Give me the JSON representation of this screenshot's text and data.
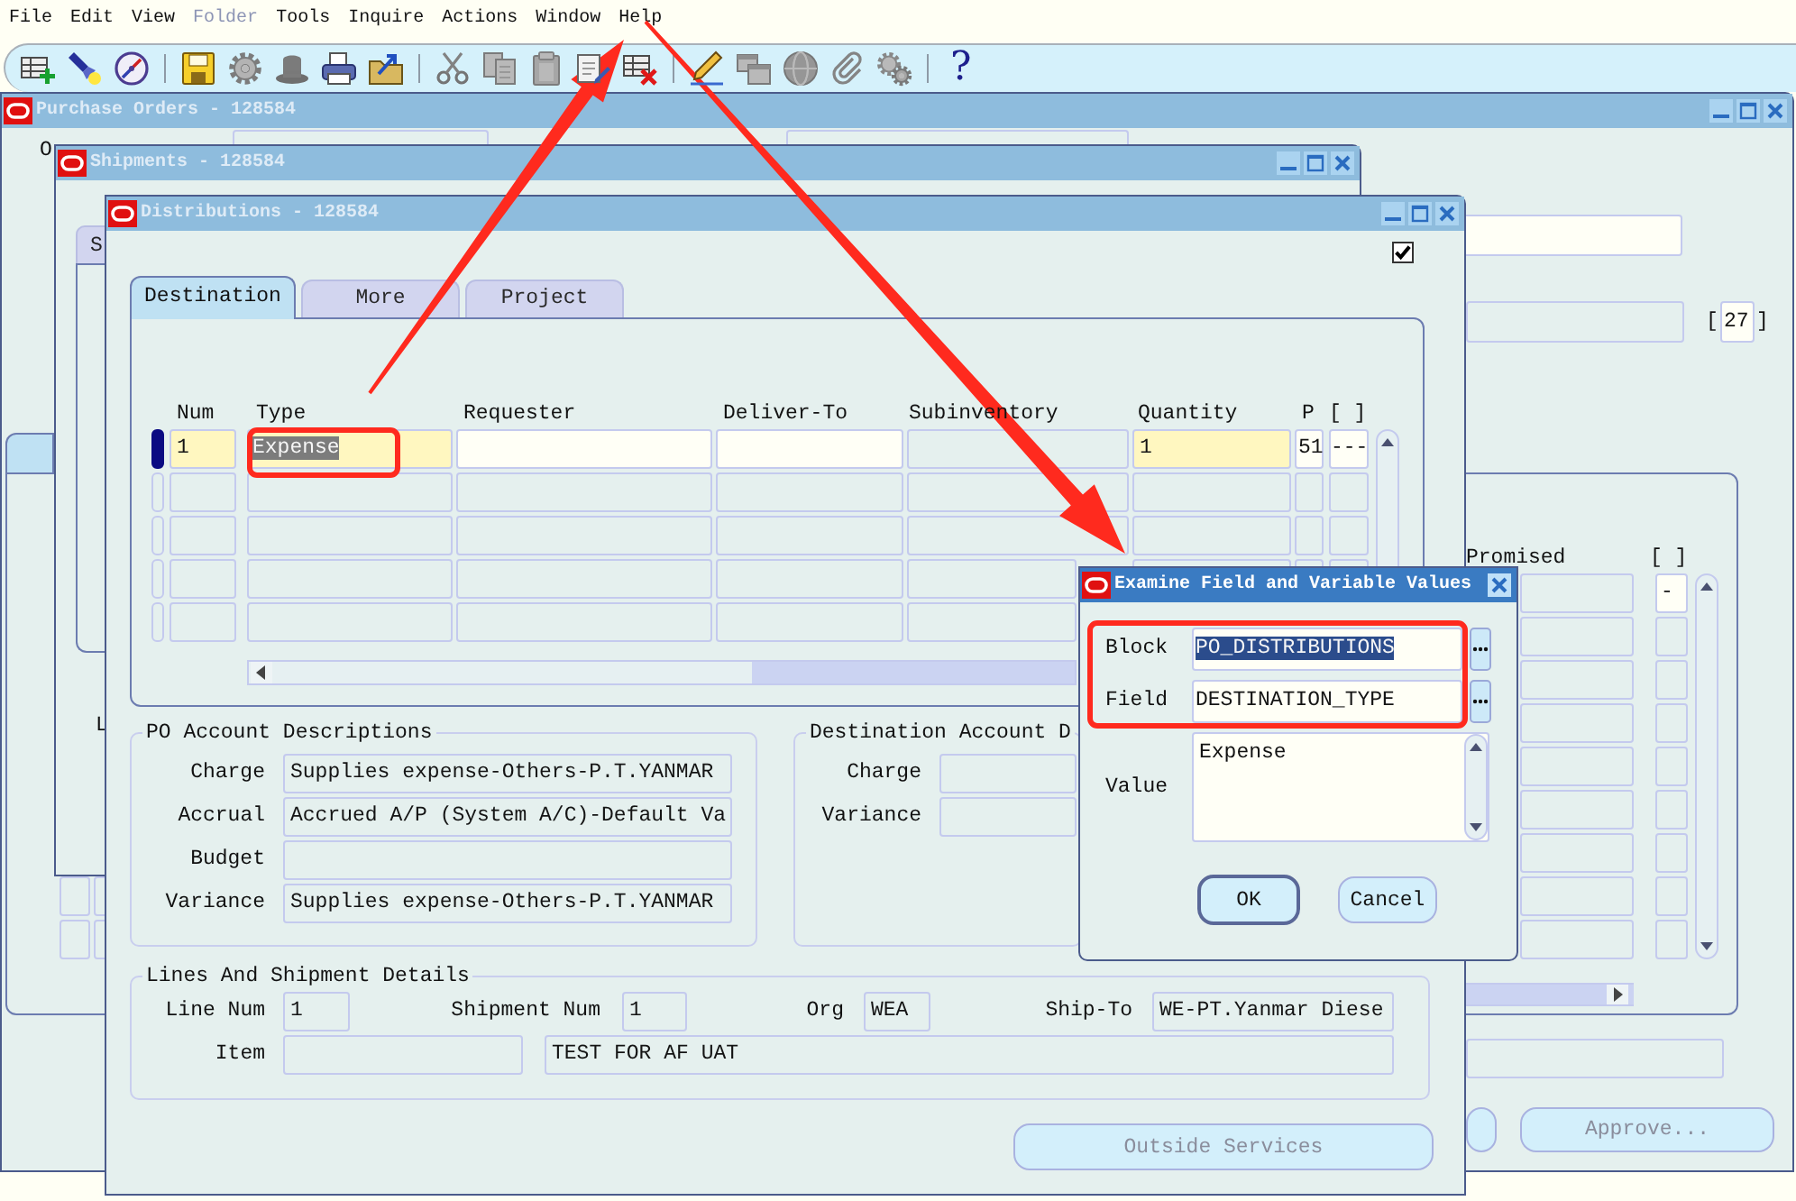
{
  "menu_bar": [
    {
      "label": "File",
      "disabled": false
    },
    {
      "label": "Edit",
      "disabled": false
    },
    {
      "label": "View",
      "disabled": false
    },
    {
      "label": "Folder",
      "disabled": true
    },
    {
      "label": "Tools",
      "disabled": false
    },
    {
      "label": "Inquire",
      "disabled": false
    },
    {
      "label": "Actions",
      "disabled": false
    },
    {
      "label": "Window",
      "disabled": false
    },
    {
      "label": "Help",
      "disabled": false
    }
  ],
  "toolbar": [
    {
      "kind": "new_record",
      "disabled": false
    },
    {
      "kind": "find",
      "disabled": false
    },
    {
      "kind": "navigator",
      "disabled": false
    },
    {
      "kind": "separator"
    },
    {
      "kind": "save",
      "disabled": false
    },
    {
      "kind": "next_step",
      "disabled": true
    },
    {
      "kind": "switch_responsibility",
      "disabled": true
    },
    {
      "kind": "print",
      "disabled": false
    },
    {
      "kind": "close_form",
      "disabled": false
    },
    {
      "kind": "separator"
    },
    {
      "kind": "cut",
      "disabled": true
    },
    {
      "kind": "copy",
      "disabled": true
    },
    {
      "kind": "paste",
      "disabled": true
    },
    {
      "kind": "clear_record",
      "disabled": false
    },
    {
      "kind": "delete_record",
      "disabled": false
    },
    {
      "kind": "separator"
    },
    {
      "kind": "edit_field",
      "disabled": false
    },
    {
      "kind": "zoom",
      "disabled": true
    },
    {
      "kind": "translations",
      "disabled": true
    },
    {
      "kind": "attachments",
      "disabled": true
    },
    {
      "kind": "folder_tools",
      "disabled": true
    },
    {
      "kind": "separator"
    },
    {
      "kind": "help",
      "glyph": "?",
      "disabled": false
    }
  ],
  "purchase_orders_window": {
    "title": "Purchase Orders - 128584",
    "active": false,
    "field_label": "O",
    "fields": [
      {
        "kind": "display"
      },
      {
        "kind": "display"
      },
      {
        "kind": "editable"
      },
      {
        "kind": "display"
      },
      {
        "kind": "display"
      }
    ],
    "flexfield": {
      "open": "[",
      "value": "27",
      "close": "]",
      "kind": "editable"
    },
    "tabs": [
      {
        "selected": true
      }
    ],
    "table": {
      "columns": [
        "Promised",
        "[ ]"
      ],
      "rows": [
        {
          "current": true,
          "flexfield": "-"
        },
        {
          "current": false
        },
        {
          "current": false
        },
        {
          "current": false
        },
        {
          "current": false
        },
        {
          "current": false
        },
        {
          "current": false
        },
        {
          "current": false
        },
        {
          "current": false
        }
      ]
    },
    "buttons": [
      {
        "kind": "blank"
      },
      {
        "kind": "labeled",
        "label": "Approve...",
        "disabled": true
      }
    ]
  },
  "shipments_window": {
    "title": "Shipments - 128584",
    "active": false,
    "tabs": [
      {
        "label": "S",
        "selected": false
      }
    ],
    "field_label": "L"
  },
  "distributions_window": {
    "title": "Distributions - 128584",
    "active": false,
    "checkbox": {
      "checked": true
    },
    "tabs": [
      {
        "label": "Destination",
        "selected": true
      },
      {
        "label": "More",
        "selected": false
      },
      {
        "label": "Project",
        "selected": false
      }
    ],
    "table": {
      "columns": [
        "Num",
        "Type",
        "Requester",
        "Deliver-To",
        "Subinventory",
        "Quantity",
        "P",
        "[ ]"
      ],
      "rows": [
        {
          "current": true,
          "cells": [
            {
              "kind": "required",
              "value": "1",
              "text_selected": false
            },
            {
              "kind": "required",
              "value": "Expense",
              "text_selected": true
            },
            {
              "kind": "editable"
            },
            {
              "kind": "editable"
            },
            {
              "kind": "display"
            },
            {
              "kind": "required",
              "value": "1",
              "text_selected": false
            },
            {
              "kind": "editable",
              "value": "51",
              "text_selected": false
            },
            {
              "kind": "editable",
              "value": "---",
              "text_selected": false
            }
          ]
        },
        {
          "current": false
        },
        {
          "current": false
        },
        {
          "current": false
        },
        {
          "current": false
        }
      ]
    },
    "po_account_descriptions": {
      "title": "PO Account Descriptions",
      "fields": [
        {
          "label": "Charge",
          "value": "Supplies expense-Others-P.T.YANMAR"
        },
        {
          "label": "Accrual",
          "value": "Accrued A/P (System A/C)-Default Va"
        },
        {
          "label": "Budget"
        },
        {
          "label": "Variance",
          "value": "Supplies expense-Others-P.T.YANMAR"
        }
      ]
    },
    "destination_account_descriptions": {
      "title": "Destination Account D",
      "fields": [
        {
          "label": "Charge"
        },
        {
          "label": "Variance"
        }
      ]
    },
    "lines_and_shipment_details": {
      "title": "Lines And Shipment Details",
      "line_num": {
        "label": "Line Num",
        "value": "1"
      },
      "shipment_num": {
        "label": "Shipment Num",
        "value": "1"
      },
      "org": {
        "label": "Org",
        "value": "WEA"
      },
      "ship_to": {
        "label": "Ship-To",
        "value": "WE-PT.Yanmar Diese"
      },
      "item": {
        "label": "Item",
        "description": "TEST FOR AF UAT"
      }
    },
    "buttons": [
      {
        "label": "Outside Services",
        "disabled": true
      }
    ]
  },
  "examine_dialog": {
    "title": "Examine Field and Variable Values",
    "active": true,
    "fields": [
      {
        "label": "Block",
        "value": "PO_DISTRIBUTIONS",
        "text_selected": true
      },
      {
        "label": "Field",
        "value": "DESTINATION_TYPE",
        "text_selected": false
      }
    ],
    "value_field": {
      "label": "Value",
      "value": "Expense"
    },
    "buttons": [
      {
        "label": "OK",
        "default": true
      },
      {
        "label": "Cancel",
        "default": false
      }
    ]
  },
  "annotations": [
    {
      "kind": "frame"
    },
    {
      "kind": "frame"
    },
    {
      "kind": "arrow"
    },
    {
      "kind": "arrow"
    }
  ]
}
